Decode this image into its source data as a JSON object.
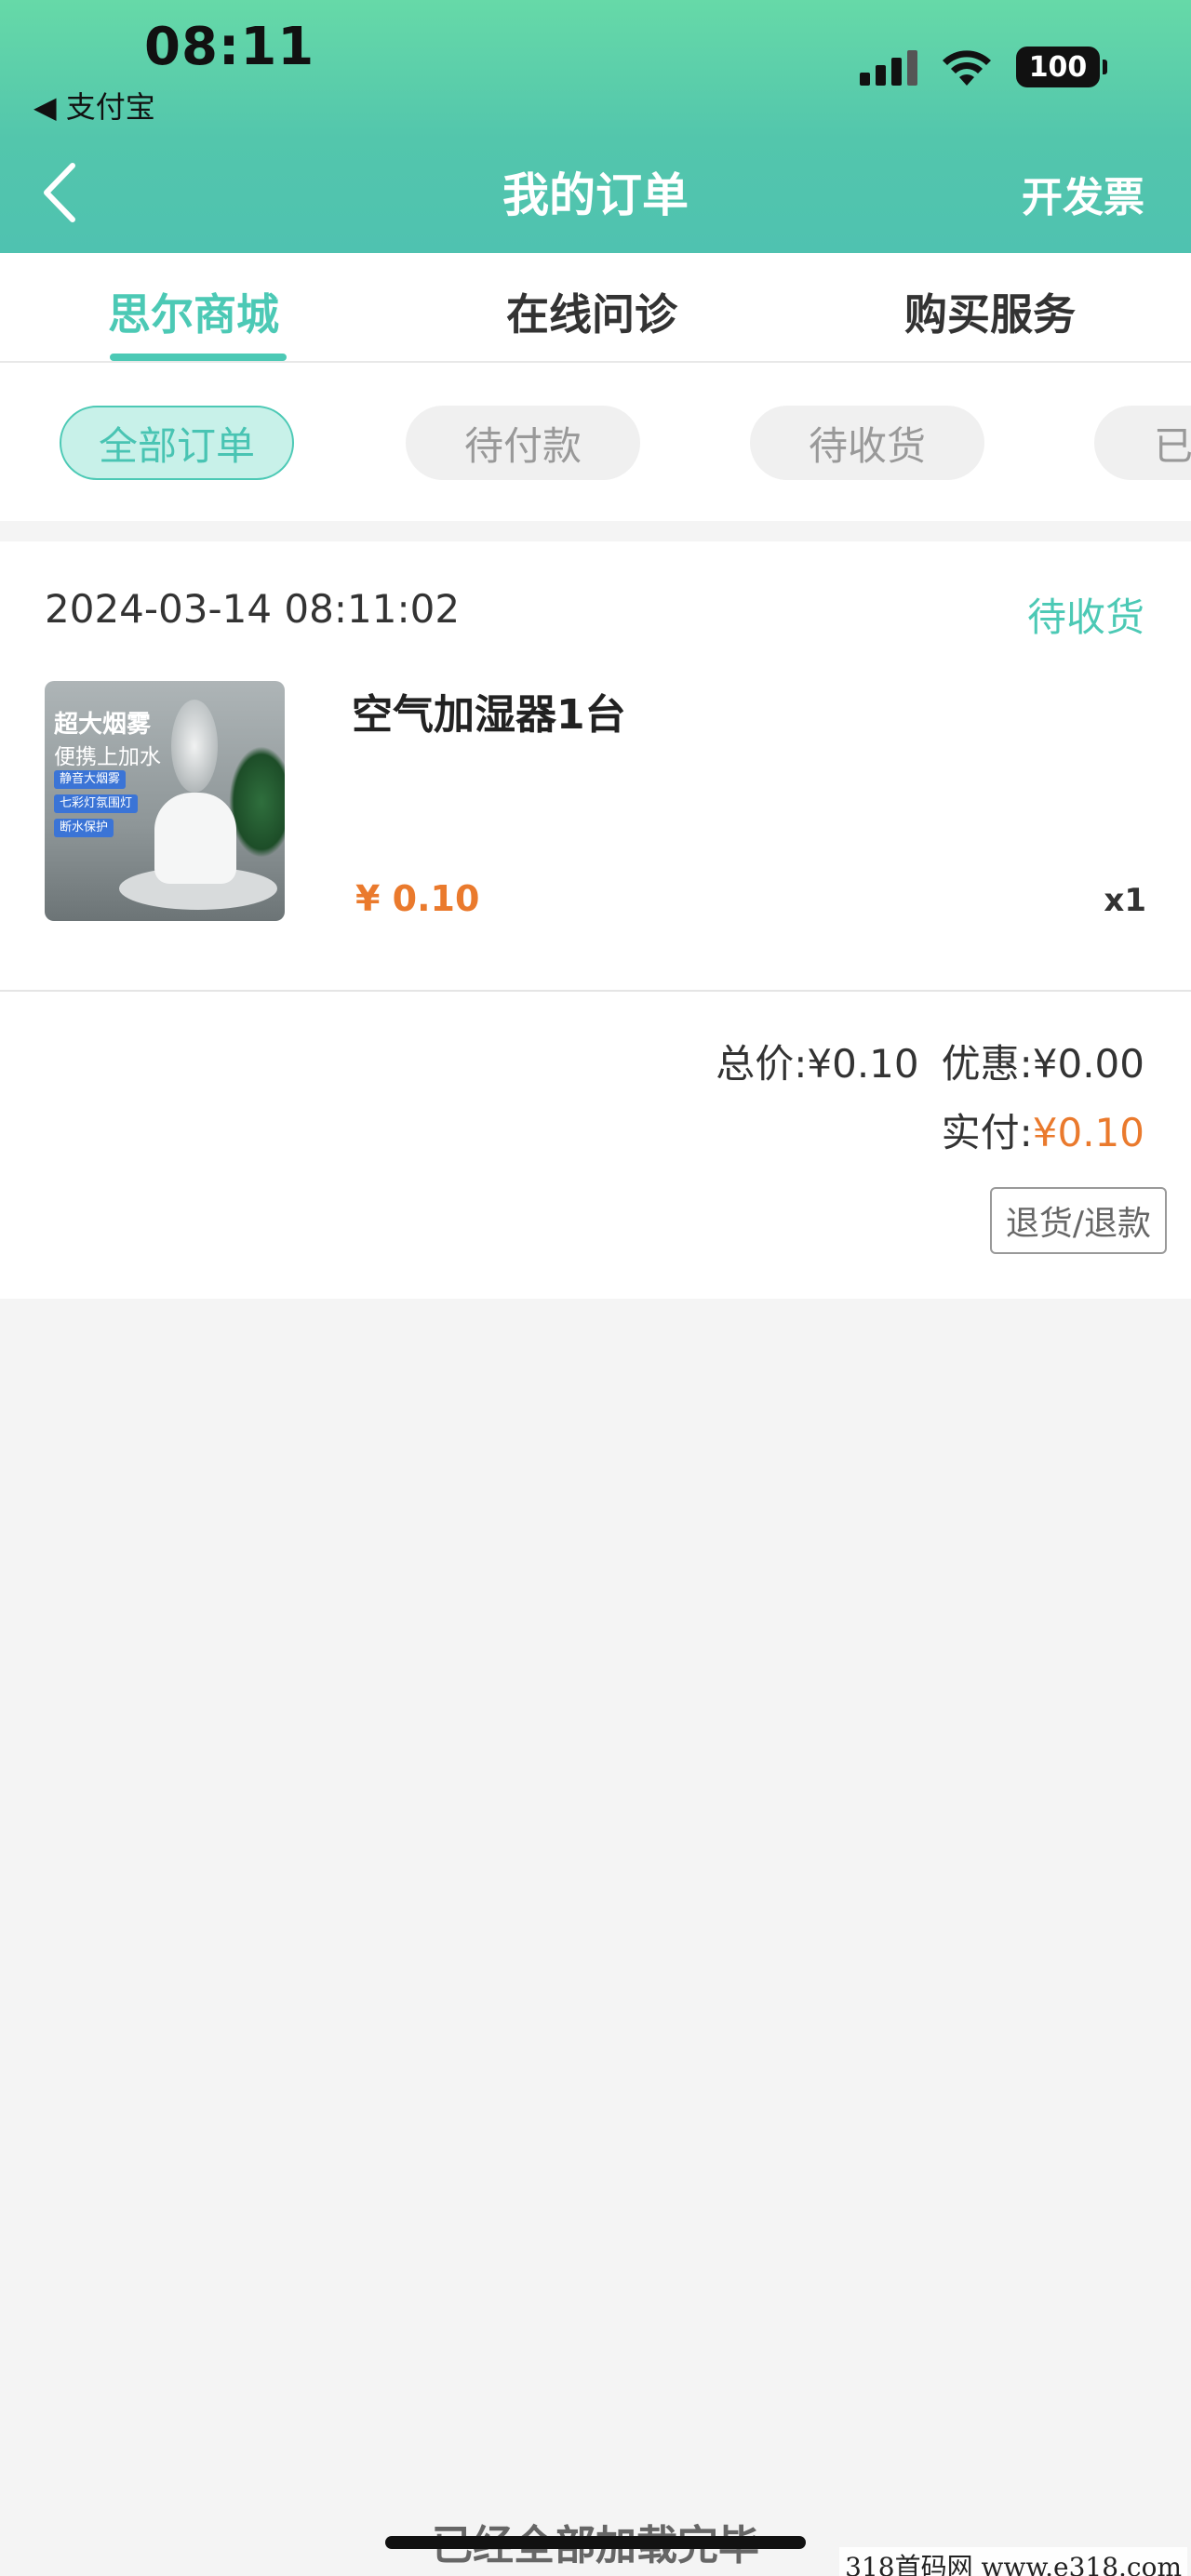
{
  "status_bar": {
    "time": "08:11",
    "back_app": "◀ 支付宝",
    "battery": "100"
  },
  "nav": {
    "title": "我的订单",
    "right_action": "开发票"
  },
  "top_tabs": [
    {
      "label": "思尔商城",
      "active": true
    },
    {
      "label": "在线问诊",
      "active": false
    },
    {
      "label": "购买服务",
      "active": false
    }
  ],
  "filters": [
    {
      "label": "全部订单",
      "active": true
    },
    {
      "label": "待付款",
      "active": false
    },
    {
      "label": "待收货",
      "active": false
    },
    {
      "label": "已",
      "active": false
    }
  ],
  "order": {
    "time": "2024-03-14 08:11:02",
    "status": "待收货",
    "thumb_text1": "超大烟雾",
    "thumb_text2": "便携上加水",
    "thumb_tags": [
      "静音大烟雾",
      "七彩灯氛围灯",
      "断水保护"
    ],
    "product_name": "空气加湿器1台",
    "price": "¥ 0.10",
    "quantity": "x1",
    "total_label": "总价:¥0.10",
    "discount_label": "优惠:¥0.00",
    "paid_label": "实付:",
    "paid_value": "¥0.10",
    "refund_button": "退货/退款"
  },
  "footer": {
    "loaded_text": "已经全部加载完毕",
    "watermark": "318首码网 www.e318.com"
  },
  "colors": {
    "accent": "#4cc9b5",
    "price": "#ea7a2d",
    "header_gradient_top": "#66d9a8"
  }
}
